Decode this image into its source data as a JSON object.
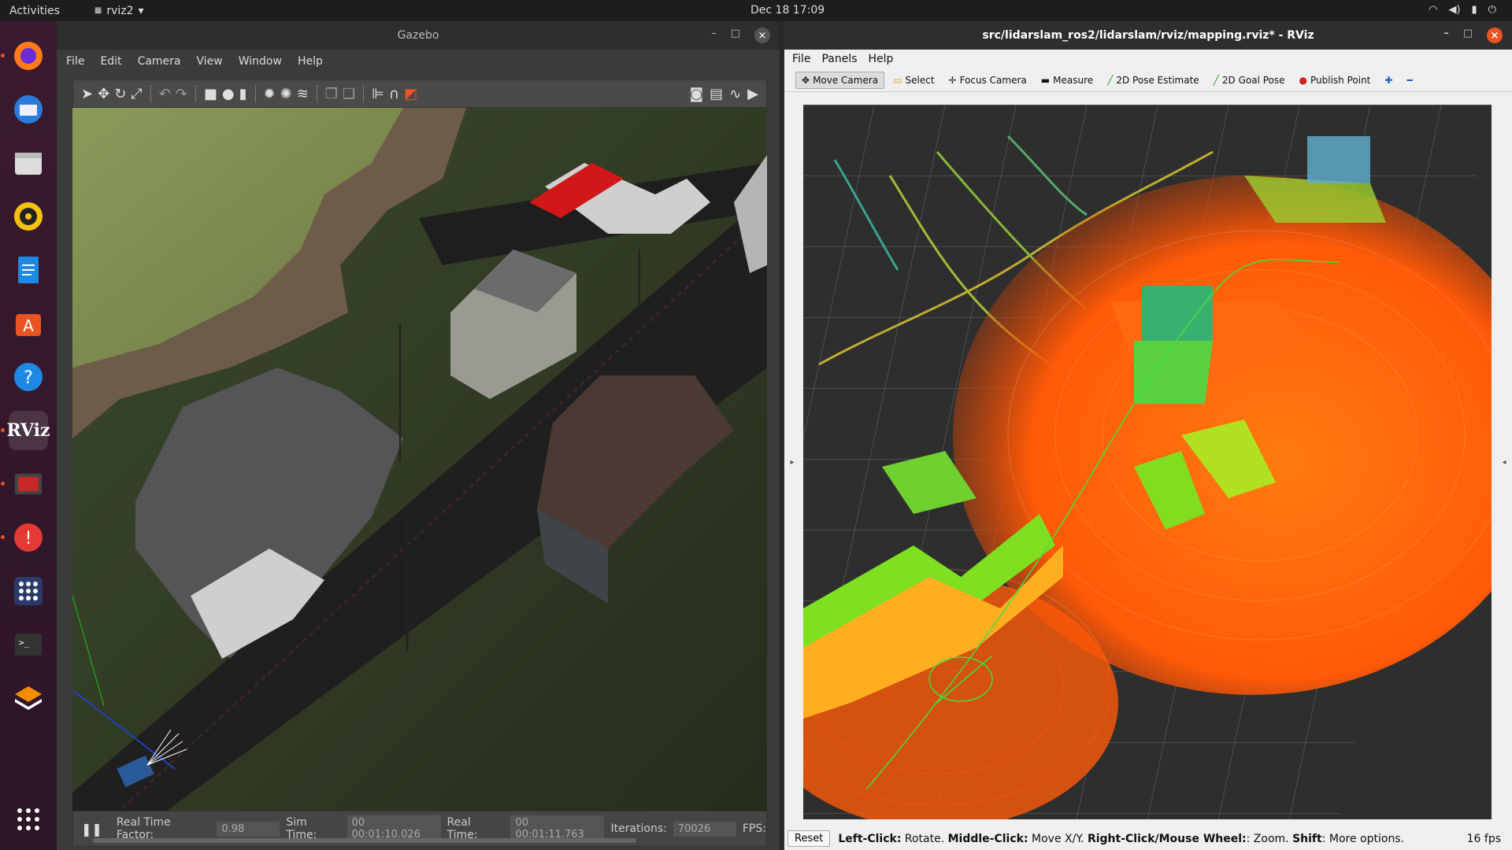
{
  "topbar": {
    "activities": "Activities",
    "app_name": "rviz2",
    "clock": "Dec 18  17:09"
  },
  "dock": [
    "firefox-icon",
    "thunderbird-icon",
    "files-icon",
    "rhythmbox-icon",
    "writer-icon",
    "software-icon",
    "help-icon",
    "rviz-icon",
    "screenshot-app-icon",
    "update-icon",
    "apps-dots-icon",
    "terminal-icon",
    "ubuntu-layers-icon"
  ],
  "rviz_dock_label": "RViz",
  "gazebo": {
    "title": "Gazebo",
    "menu": [
      "File",
      "Edit",
      "Camera",
      "View",
      "Window",
      "Help"
    ],
    "status": {
      "rtf_label": "Real Time Factor:",
      "rtf": "0.98",
      "sim_label": "Sim Time:",
      "sim": "00 00:01:10.026",
      "real_label": "Real Time:",
      "real": "00 00:01:11.763",
      "iter_label": "Iterations:",
      "iter": "70026",
      "fps_label": "FPS:"
    }
  },
  "rviz": {
    "title": "src/lidarslam_ros2/lidarslam/rviz/mapping.rviz* - RViz",
    "menu": [
      "File",
      "Panels",
      "Help"
    ],
    "tools": [
      "Move Camera",
      "Select",
      "Focus Camera",
      "Measure",
      "2D Pose Estimate",
      "2D Goal Pose",
      "Publish Point"
    ],
    "reset": "Reset",
    "hint": {
      "a": "Left-Click:",
      "a2": " Rotate. ",
      "b": "Middle-Click:",
      "b2": " Move X/Y. ",
      "c": "Right-Click/Mouse Wheel:",
      "c2": ": Zoom. ",
      "d": "Shift",
      "d2": ": More options."
    },
    "fps": "16 fps"
  },
  "colors": {
    "accent": "#e95420",
    "cloud_orange": "#ff6a10",
    "cloud_green": "#7fe020"
  }
}
